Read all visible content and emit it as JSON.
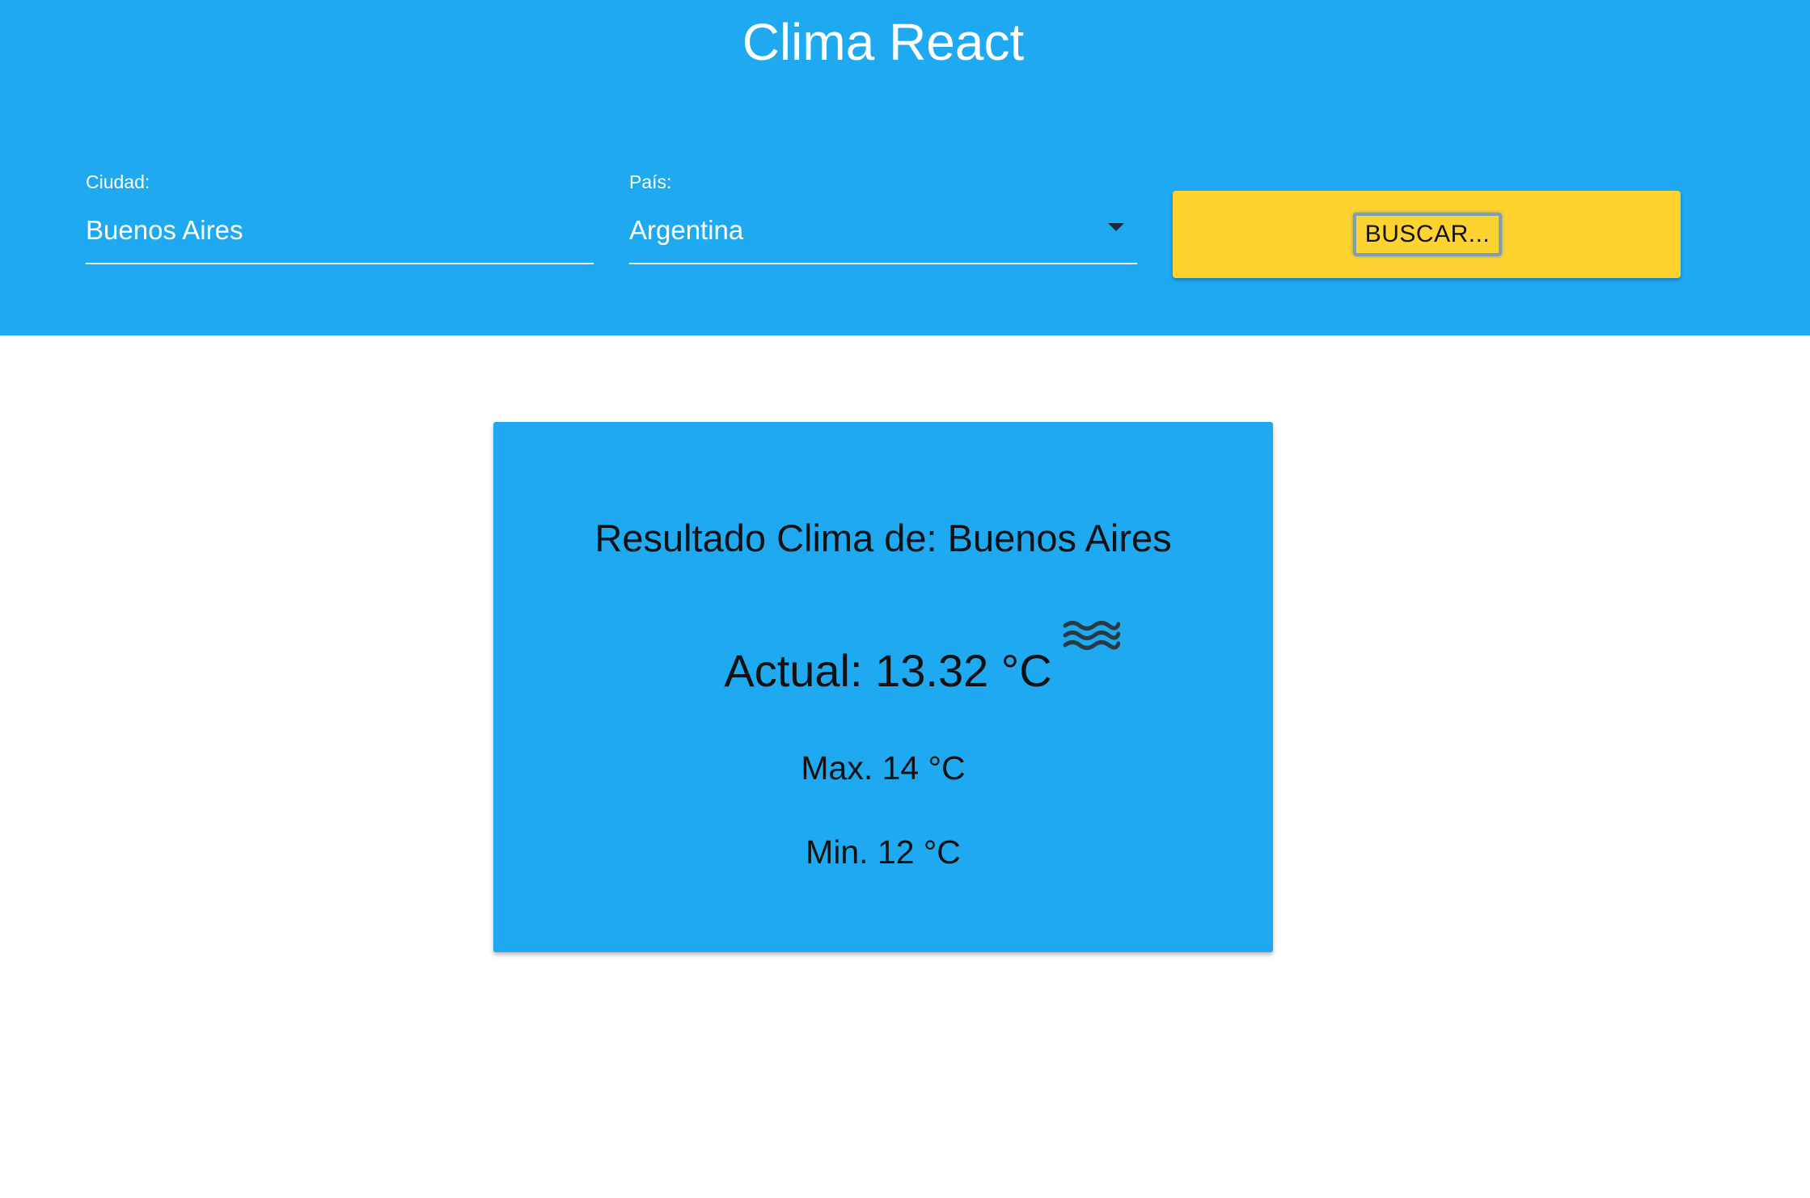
{
  "app": {
    "title": "Clima React"
  },
  "form": {
    "city": {
      "label": "Ciudad:",
      "value": "Buenos Aires"
    },
    "country": {
      "label": "País:",
      "selected": "Argentina"
    },
    "search_button_label": "BUSCAR..."
  },
  "result": {
    "title": "Resultado Clima de: Buenos Aires",
    "current": "Actual: 13.32 °C",
    "max": "Max. 14 °C",
    "min": "Min. 12 °C",
    "weather_icon": "wind-waves-icon"
  },
  "colors": {
    "primary": "#1fa9f1",
    "button": "#fed330",
    "text_light": "#ffffff",
    "text_dark": "#111111"
  }
}
